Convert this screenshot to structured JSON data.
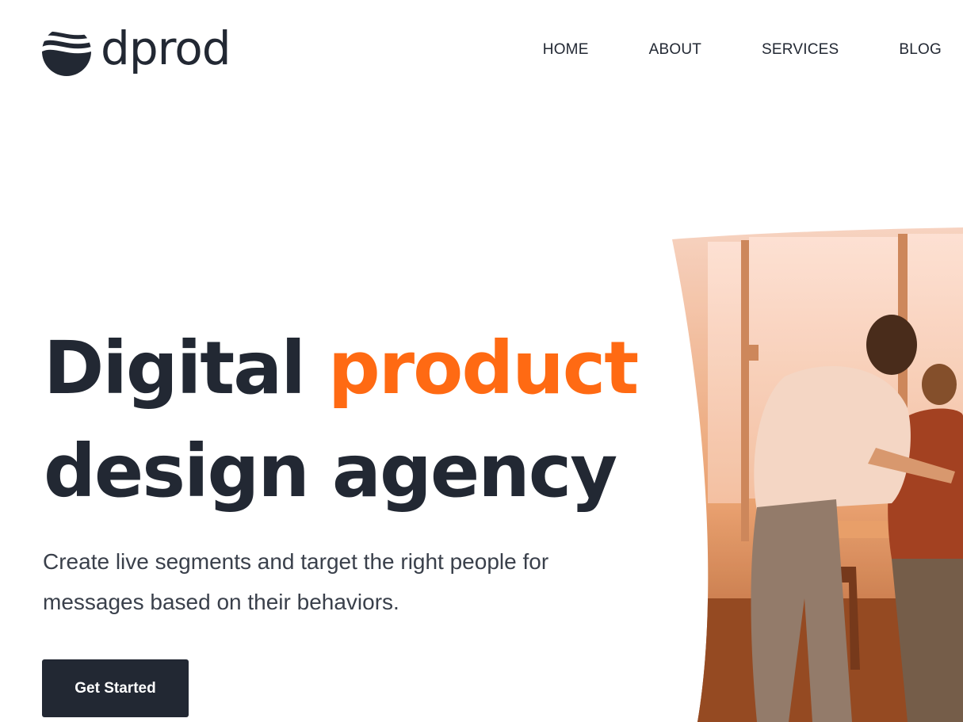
{
  "brand": {
    "name": "dprod",
    "color": "#222833",
    "accent": "#ff6a13"
  },
  "nav": {
    "items": [
      {
        "label": "HOME"
      },
      {
        "label": "ABOUT"
      },
      {
        "label": "SERVICES"
      },
      {
        "label": "BLOG"
      }
    ]
  },
  "hero": {
    "title_line1_prefix": "Digital ",
    "title_line1_accent": "product",
    "title_line2": "design agency",
    "subtitle": "Create live segments and target the right people for messages based on their behaviors.",
    "cta_label": "Get Started",
    "image_icon": "team-at-laptop-photo"
  }
}
